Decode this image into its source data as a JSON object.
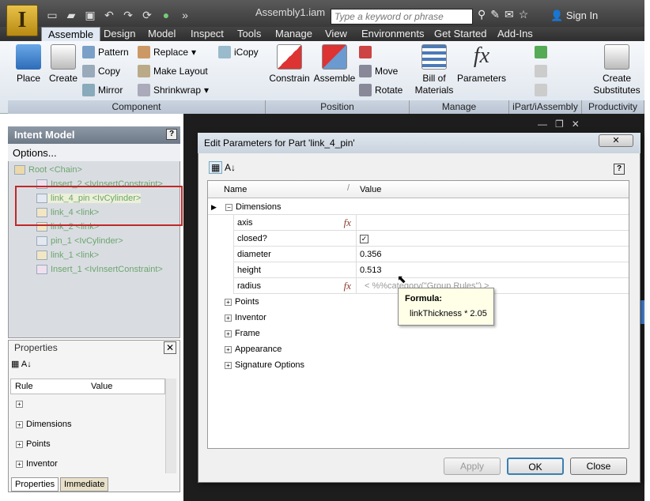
{
  "window": {
    "title": "Assembly1.iam",
    "search_placeholder": "Type a keyword or phrase",
    "sign_in": "Sign In",
    "app_letter": "I"
  },
  "tabs": [
    "Assemble",
    "Design",
    "Model",
    "Inspect",
    "Tools",
    "Manage",
    "View",
    "Environments",
    "Get Started",
    "Add-Ins"
  ],
  "ribbon": {
    "place": "Place",
    "create": "Create",
    "pattern": "Pattern",
    "copy": "Copy",
    "mirror": "Mirror",
    "replace": "Replace",
    "make_layout": "Make Layout",
    "shrinkwrap": "Shrinkwrap",
    "icopy": "iCopy",
    "constrain": "Constrain",
    "assemble": "Assemble",
    "move": "Move",
    "rotate": "Rotate",
    "bom": "Bill of",
    "bom2": "Materials",
    "parameters": "Parameters",
    "create_subs": "Create",
    "create_subs2": "Substitutes",
    "groups": {
      "component": "Component",
      "position": "Position",
      "manage": "Manage",
      "ipart": "iPart/iAssembly",
      "productivity": "Productivity"
    }
  },
  "intent": {
    "title": "Intent Model",
    "options": "Options...",
    "tree": [
      "Root <Chain>",
      "Insert_2 <IvInsertConstraint>",
      "link_4_pin <IvCylinder>",
      "link_4 <link>",
      "link_2 <link>",
      "pin_1 <IvCylinder>",
      "link_1 <link>",
      "Insert_1 <IvInsertConstraint>"
    ]
  },
  "properties": {
    "title": "Properties",
    "col_rule": "Rule",
    "col_value": "Value",
    "rows": [
      "Dimensions",
      "Points",
      "Inventor"
    ],
    "tab1": "Properties",
    "tab2": "Immediate"
  },
  "dialog": {
    "title": "Edit Parameters for Part 'link_4_pin'",
    "col_name": "Name",
    "col_value": "Value",
    "group_dimensions": "Dimensions",
    "params": [
      {
        "name": "axis",
        "value": ""
      },
      {
        "name": "closed?",
        "value": ""
      },
      {
        "name": "diameter",
        "value": "0.356"
      },
      {
        "name": "height",
        "value": "0.513"
      },
      {
        "name": "radius",
        "value": "< %%category(\"Group Rules\") >"
      }
    ],
    "groups": [
      "Points",
      "Inventor",
      "Frame",
      "Appearance",
      "Signature Options"
    ],
    "apply": "Apply",
    "ok": "OK",
    "close": "Close"
  },
  "tooltip": {
    "title": "Formula:",
    "text": "linkThickness * 2.05"
  }
}
